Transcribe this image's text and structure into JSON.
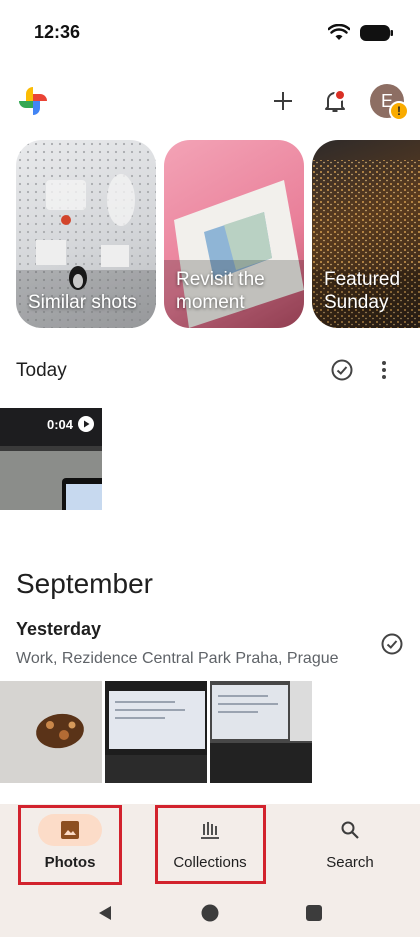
{
  "status_bar": {
    "time": "12:36"
  },
  "app_bar": {
    "logo": "google-photos-logo",
    "add_icon": "plus-icon",
    "notifications_icon": "bell-icon",
    "avatar_initial": "E",
    "avatar_badge": "!"
  },
  "memories": [
    {
      "label": "Similar shots"
    },
    {
      "label": "Revisit the moment"
    },
    {
      "label": "Featured Sunday"
    }
  ],
  "today": {
    "title": "Today",
    "video_duration": "0:04"
  },
  "september": {
    "month": "September",
    "day_title": "Yesterday",
    "location": "Work, Rezidence Central Park Praha, Prague"
  },
  "bottom_nav": {
    "items": [
      {
        "label": "Photos",
        "icon": "photo-icon",
        "active": true
      },
      {
        "label": "Collections",
        "icon": "collections-icon",
        "active": false
      },
      {
        "label": "Search",
        "icon": "search-icon",
        "active": false
      }
    ]
  },
  "colors": {
    "nav_bg": "#f3ede9",
    "active_pill": "#fcdcc8",
    "accent": "#8d4f21",
    "annotation": "#d2222d"
  }
}
